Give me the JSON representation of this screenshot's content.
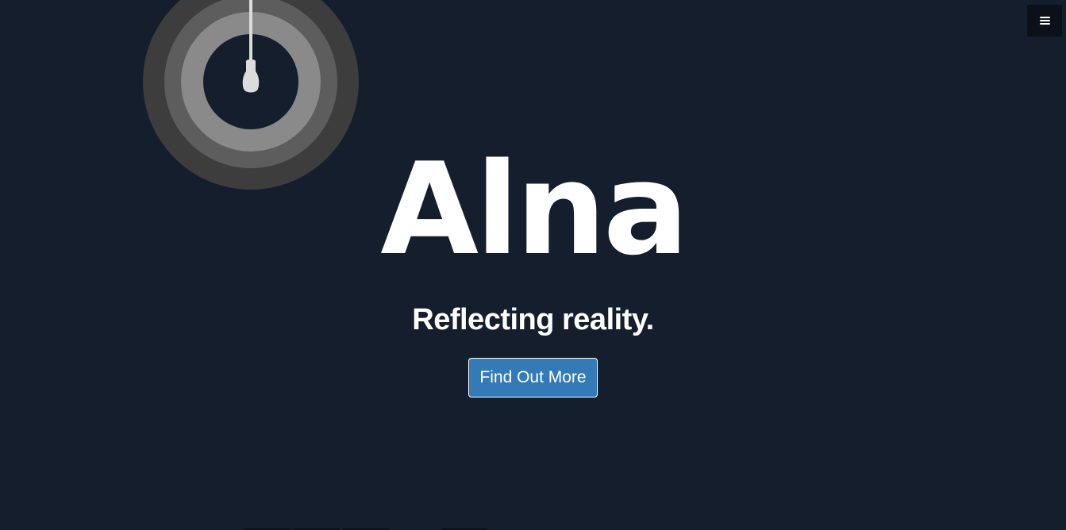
{
  "hero": {
    "title": "Alna",
    "subtitle": "Reflecting reality.",
    "cta_label": "Find Out More"
  },
  "header": {
    "menu_icon": "hamburger-menu-icon"
  },
  "decor": {
    "lamp_icon": "hanging-bulb-icon"
  },
  "colors": {
    "background": "#151e2c",
    "accent": "#337ab7",
    "text": "#ffffff",
    "menu_bg": "#0c1119"
  }
}
